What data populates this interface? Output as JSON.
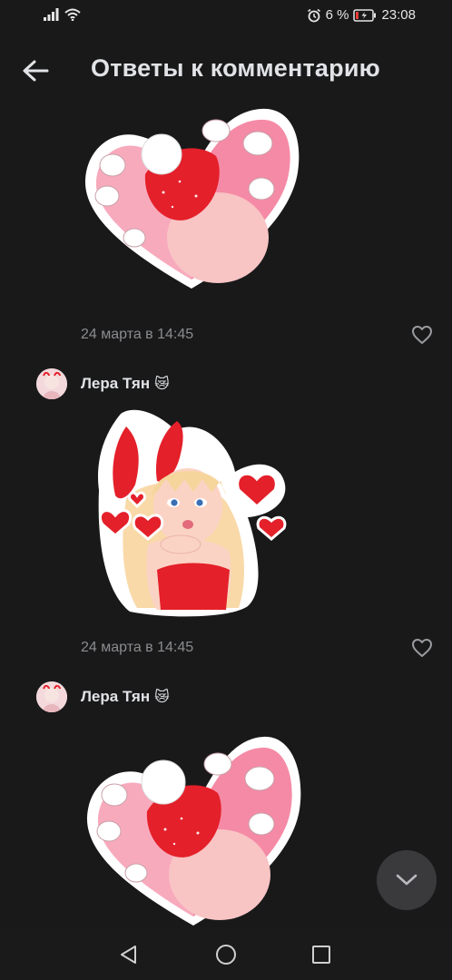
{
  "status_bar": {
    "battery_percent": "6 %",
    "time": "23:08"
  },
  "header": {
    "title": "Ответы к комментарию"
  },
  "comments": [
    {
      "timestamp": "24 марта в 14:45"
    },
    {
      "author": "Лера Тян",
      "author_emoji": "😿",
      "timestamp": "24 марта в 14:45"
    },
    {
      "author": "Лера Тян",
      "author_emoji": "😿"
    }
  ],
  "icons": {
    "back": "arrow-left",
    "like": "heart-outline",
    "scroll": "chevron-down",
    "nav": [
      "triangle-back",
      "circle-home",
      "square-recents"
    ]
  },
  "colors": {
    "background": "#19191a",
    "text_primary": "#e1e3e6",
    "text_secondary": "#8a8c8f",
    "sticker_red": "#e4202a",
    "sticker_pink": "#f7a7b8"
  }
}
